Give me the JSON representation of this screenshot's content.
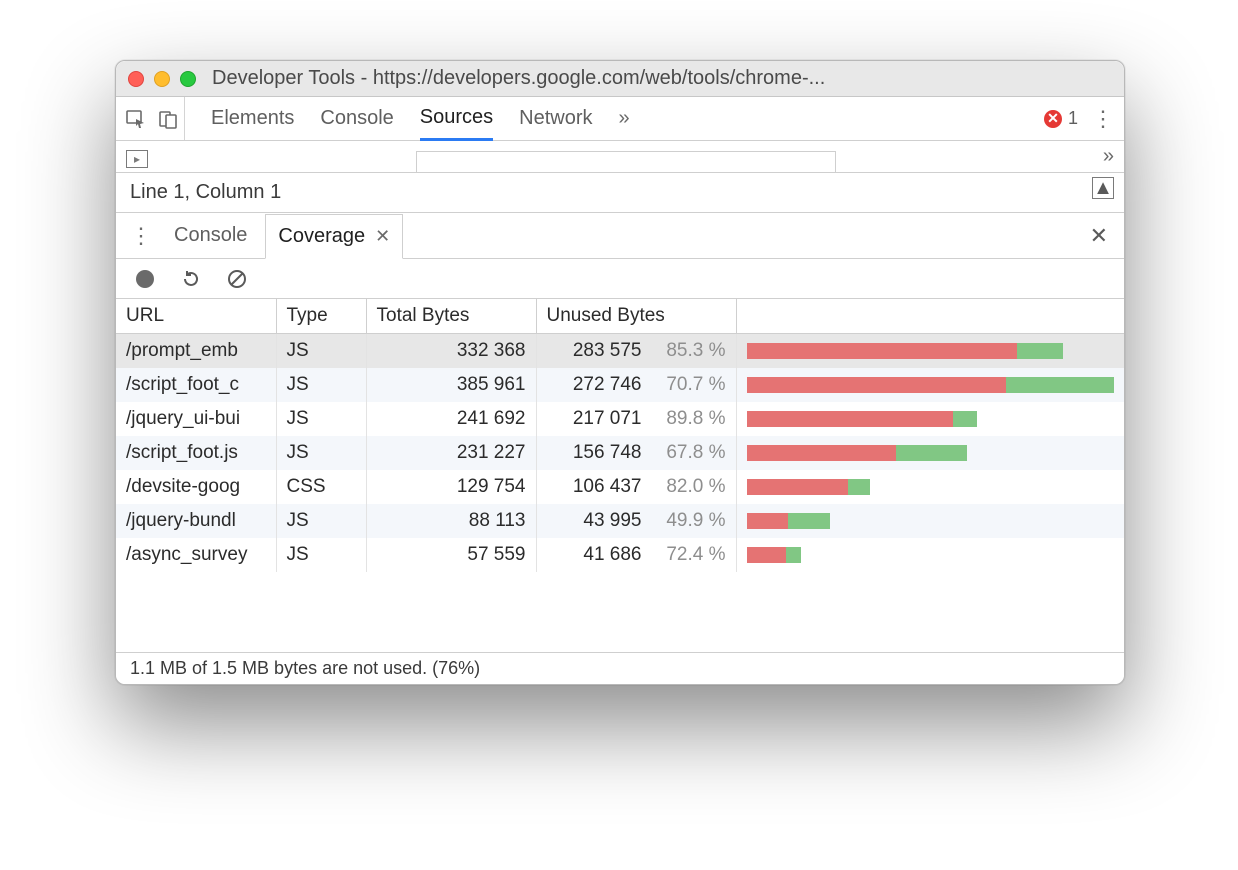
{
  "window_title": "Developer Tools - https://developers.google.com/web/tools/chrome-...",
  "main_tabs": [
    "Elements",
    "Console",
    "Sources",
    "Network"
  ],
  "main_tab_active_index": 2,
  "errors_count": "1",
  "status_line": "Line 1, Column 1",
  "drawer_tabs": [
    "Console",
    "Coverage"
  ],
  "drawer_tab_active_index": 1,
  "coverage": {
    "columns": [
      "URL",
      "Type",
      "Total Bytes",
      "Unused Bytes"
    ],
    "max_total_bytes": 385961,
    "rows": [
      {
        "url": "/prompt_emb",
        "type": "JS",
        "total_bytes": "332 368",
        "unused_bytes": "283 575",
        "pct": "85.3 %",
        "total_num": 332368,
        "unused_num": 283575,
        "selected": true
      },
      {
        "url": "/script_foot_c",
        "type": "JS",
        "total_bytes": "385 961",
        "unused_bytes": "272 746",
        "pct": "70.7 %",
        "total_num": 385961,
        "unused_num": 272746
      },
      {
        "url": "/jquery_ui-bui",
        "type": "JS",
        "total_bytes": "241 692",
        "unused_bytes": "217 071",
        "pct": "89.8 %",
        "total_num": 241692,
        "unused_num": 217071
      },
      {
        "url": "/script_foot.js",
        "type": "JS",
        "total_bytes": "231 227",
        "unused_bytes": "156 748",
        "pct": "67.8 %",
        "total_num": 231227,
        "unused_num": 156748
      },
      {
        "url": "/devsite-goog",
        "type": "CSS",
        "total_bytes": "129 754",
        "unused_bytes": "106 437",
        "pct": "82.0 %",
        "total_num": 129754,
        "unused_num": 106437
      },
      {
        "url": "/jquery-bundl",
        "type": "JS",
        "total_bytes": "88 113",
        "unused_bytes": "43 995",
        "pct": "49.9 %",
        "total_num": 88113,
        "unused_num": 43995
      },
      {
        "url": "/async_survey",
        "type": "JS",
        "total_bytes": "57 559",
        "unused_bytes": "41 686",
        "pct": "72.4 %",
        "total_num": 57559,
        "unused_num": 41686
      }
    ],
    "summary": "1.1 MB of 1.5 MB bytes are not used. (76%)"
  }
}
